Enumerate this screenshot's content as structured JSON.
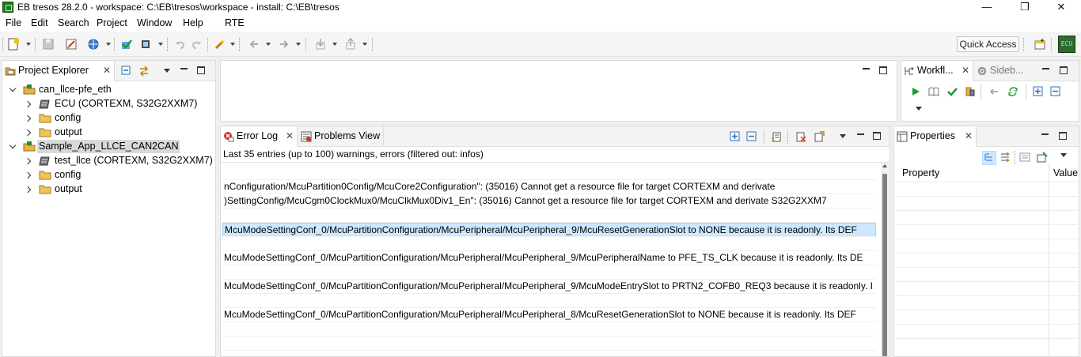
{
  "window": {
    "title": "EB tresos 28.2.0 - workspace: C:\\EB\\tresos\\workspace - install: C:\\EB\\tresos",
    "minimize": "—",
    "maximize": "❐",
    "close": "✕"
  },
  "menu": [
    "File",
    "Edit",
    "Search",
    "Project",
    "Window",
    "Help",
    "RTE"
  ],
  "toolbar": {
    "quick_access": "Quick Access",
    "ecu_badge": "ECU"
  },
  "project_explorer": {
    "tab_label": "Project Explorer",
    "tree": [
      {
        "label": "can_llce-pfe_eth",
        "kind": "project",
        "expanded": true,
        "depth": 0
      },
      {
        "label": "ECU (CORTEXM, S32G2XXM7)",
        "kind": "ecu",
        "expanded": false,
        "depth": 1
      },
      {
        "label": "config",
        "kind": "folder",
        "expanded": false,
        "depth": 1
      },
      {
        "label": "output",
        "kind": "folder",
        "expanded": false,
        "depth": 1
      },
      {
        "label": "Sample_App_LLCE_CAN2CAN",
        "kind": "project",
        "expanded": true,
        "depth": 0,
        "selected": true
      },
      {
        "label": "test_llce (CORTEXM, S32G2XXM7)",
        "kind": "ecu",
        "expanded": false,
        "depth": 1
      },
      {
        "label": "config",
        "kind": "folder",
        "expanded": false,
        "depth": 1
      },
      {
        "label": "output",
        "kind": "folder",
        "expanded": false,
        "depth": 1
      }
    ]
  },
  "error_log": {
    "tab_label": "Error Log",
    "other_tab_label": "Problems View",
    "summary": "Last 35 entries (up to 100) warnings, errors (filtered out: infos)",
    "rows": [
      "",
      "nConfiguration/McuPartition0Config/McuCore2Configuration\": (35016) Cannot get a resource file for target CORTEXM and derivate",
      ")SettingConfig/McuCgm0ClockMux0/McuClkMux0Div1_En\": (35016) Cannot get a resource file for target CORTEXM and derivate S32G2XXM7",
      "",
      "McuModeSettingConf_0/McuPartitionConfiguration/McuPeripheral/McuPeripheral_9/McuResetGenerationSlot to NONE because it is readonly. Its DEF",
      "",
      "McuModeSettingConf_0/McuPartitionConfiguration/McuPeripheral/McuPeripheral_9/McuPeripheralName to PFE_TS_CLK because it is readonly. Its DE",
      "",
      "McuModeSettingConf_0/McuPartitionConfiguration/McuPeripheral/McuPeripheral_9/McuModeEntrySlot to PRTN2_COFB0_REQ3 because it is readonly. I",
      "",
      "McuModeSettingConf_0/McuPartitionConfiguration/McuPeripheral/McuPeripheral_8/McuResetGenerationSlot to NONE because it is readonly. Its DEF",
      "",
      "",
      ""
    ],
    "selected_row": 4
  },
  "workflows": {
    "tab_label": "Workfl...",
    "other_tab_label": "Sideb..."
  },
  "properties": {
    "tab_label": "Properties",
    "col_property": "Property",
    "col_value": "Value"
  },
  "colors": {
    "selection_bg": "#cde8ff",
    "selection_border": "#99d1ff",
    "tree_selected_bg": "#d9d9d9",
    "run_green": "#1d9b2f"
  }
}
